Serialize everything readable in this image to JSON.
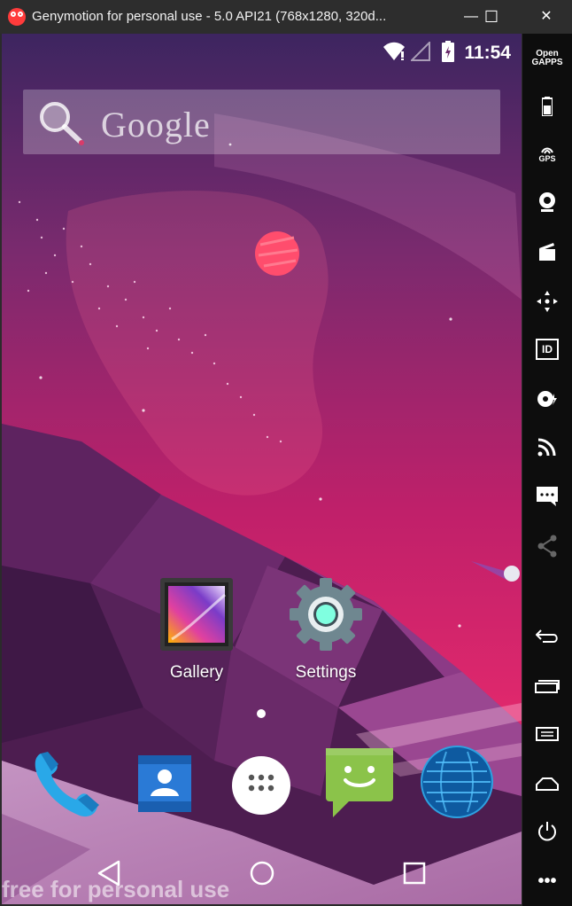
{
  "window": {
    "title": "Genymotion for personal use - 5.0 API21 (768x1280, 320d...",
    "minimize_glyph": "—",
    "maximize_glyph": "☐",
    "close_glyph": "✕"
  },
  "status_bar": {
    "time": "11:54",
    "icons": [
      "wifi-icon",
      "signal-icon",
      "battery-charging-icon"
    ]
  },
  "search": {
    "brand": "Google",
    "icon": "search-icon"
  },
  "home_apps": [
    {
      "label": "Gallery",
      "icon": "gallery-icon"
    },
    {
      "label": "Settings",
      "icon": "settings-icon"
    }
  ],
  "dock": [
    "phone-icon",
    "contacts-icon",
    "app-drawer-icon",
    "messaging-icon",
    "browser-icon"
  ],
  "nav": [
    "back-icon",
    "home-icon",
    "recents-icon"
  ],
  "watermark": "free for personal use",
  "sidebar": {
    "items": [
      {
        "label": "Open\nGAPPS",
        "icon": "open-gapps-icon"
      },
      {
        "label": "",
        "icon": "battery-icon"
      },
      {
        "label": "GPS",
        "icon": "gps-icon"
      },
      {
        "label": "",
        "icon": "webcam-icon"
      },
      {
        "label": "",
        "icon": "media-icon"
      },
      {
        "label": "",
        "icon": "remote-control-icon"
      },
      {
        "label": "ID",
        "icon": "device-id-icon"
      },
      {
        "label": "",
        "icon": "disk-io-icon"
      },
      {
        "label": "",
        "icon": "network-icon"
      },
      {
        "label": "",
        "icon": "sms-icon"
      },
      {
        "label": "",
        "icon": "share-icon"
      },
      {
        "label": "",
        "icon": "android-back-icon"
      },
      {
        "label": "",
        "icon": "android-recents-icon"
      },
      {
        "label": "",
        "icon": "android-menu-icon"
      },
      {
        "label": "",
        "icon": "android-home-icon"
      },
      {
        "label": "",
        "icon": "power-icon"
      },
      {
        "label": "•••",
        "icon": "more-icon"
      }
    ]
  },
  "colors": {
    "sky_top": "#4a2a63",
    "sky_pink": "#d51f6a",
    "mountain_dark": "#4a1f4f",
    "planet": "#ff4d6d"
  }
}
